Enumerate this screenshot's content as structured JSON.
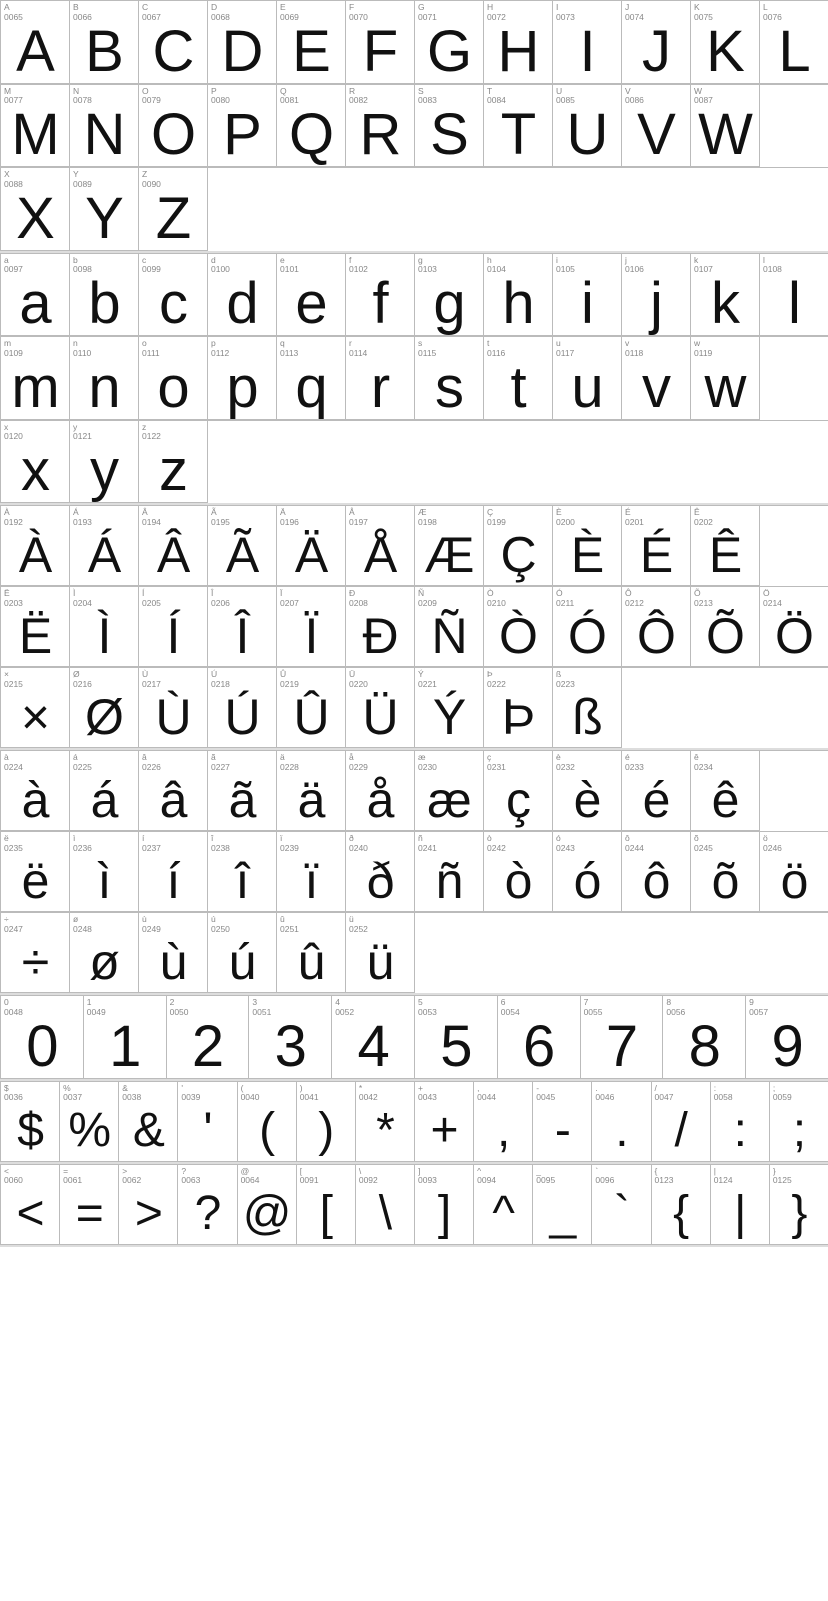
{
  "sections": [
    {
      "id": "uppercase",
      "rows": [
        {
          "cells": [
            {
              "code": "A\n0065",
              "char": "A"
            },
            {
              "code": "B\n0066",
              "char": "B"
            },
            {
              "code": "C\n0067",
              "char": "C"
            },
            {
              "code": "D\n0068",
              "char": "D"
            },
            {
              "code": "E\n0069",
              "char": "E"
            },
            {
              "code": "F\n0070",
              "char": "F"
            },
            {
              "code": "G\n0071",
              "char": "G"
            },
            {
              "code": "H\n0072",
              "char": "H"
            },
            {
              "code": "I\n0073",
              "char": "I"
            },
            {
              "code": "J\n0074",
              "char": "J"
            },
            {
              "code": "K\n0075",
              "char": "K"
            },
            {
              "code": "L\n0076",
              "char": "L"
            }
          ]
        },
        {
          "cells": [
            {
              "code": "M\n0077",
              "char": "M"
            },
            {
              "code": "N\n0078",
              "char": "N"
            },
            {
              "code": "O\n0079",
              "char": "O"
            },
            {
              "code": "P\n0080",
              "char": "P"
            },
            {
              "code": "Q\n0081",
              "char": "Q"
            },
            {
              "code": "R\n0082",
              "char": "R"
            },
            {
              "code": "S\n0083",
              "char": "S"
            },
            {
              "code": "T\n0084",
              "char": "T"
            },
            {
              "code": "U\n0085",
              "char": "U"
            },
            {
              "code": "V\n0086",
              "char": "V"
            },
            {
              "code": "W\n0087",
              "char": "W"
            }
          ]
        },
        {
          "cells": [
            {
              "code": "X\n0088",
              "char": "X"
            },
            {
              "code": "Y\n0089",
              "char": "Y"
            },
            {
              "code": "Z\n0090",
              "char": "Z"
            }
          ],
          "partial": true
        }
      ]
    },
    {
      "id": "lowercase",
      "rows": [
        {
          "cells": [
            {
              "code": "a\n0097",
              "char": "a"
            },
            {
              "code": "b\n0098",
              "char": "b"
            },
            {
              "code": "c\n0099",
              "char": "c"
            },
            {
              "code": "d\n0100",
              "char": "d"
            },
            {
              "code": "e\n0101",
              "char": "e"
            },
            {
              "code": "f\n0102",
              "char": "f"
            },
            {
              "code": "g\n0103",
              "char": "g"
            },
            {
              "code": "h\n0104",
              "char": "h"
            },
            {
              "code": "i\n0105",
              "char": "i"
            },
            {
              "code": "j\n0106",
              "char": "j"
            },
            {
              "code": "k\n0107",
              "char": "k"
            },
            {
              "code": "l\n0108",
              "char": "l"
            }
          ]
        },
        {
          "cells": [
            {
              "code": "m\n0109",
              "char": "m"
            },
            {
              "code": "n\n0110",
              "char": "n"
            },
            {
              "code": "o\n0111",
              "char": "o"
            },
            {
              "code": "p\n0112",
              "char": "p"
            },
            {
              "code": "q\n0113",
              "char": "q"
            },
            {
              "code": "r\n0114",
              "char": "r"
            },
            {
              "code": "s\n0115",
              "char": "s"
            },
            {
              "code": "t\n0116",
              "char": "t"
            },
            {
              "code": "u\n0117",
              "char": "u"
            },
            {
              "code": "v\n0118",
              "char": "v"
            },
            {
              "code": "w\n0119",
              "char": "w"
            }
          ]
        },
        {
          "cells": [
            {
              "code": "x\n0120",
              "char": "x"
            },
            {
              "code": "y\n0121",
              "char": "y"
            },
            {
              "code": "z\n0122",
              "char": "z"
            }
          ],
          "partial": true
        }
      ]
    },
    {
      "id": "accented-upper",
      "rows": [
        {
          "cells": [
            {
              "code": "À\n0192",
              "char": "À"
            },
            {
              "code": "Á\n0193",
              "char": "Á"
            },
            {
              "code": "Â\n0194",
              "char": "Â"
            },
            {
              "code": "Ã\n0195",
              "char": "Ã"
            },
            {
              "code": "Ä\n0196",
              "char": "Ä"
            },
            {
              "code": "Å\n0197",
              "char": "Å"
            },
            {
              "code": "Æ\n0198",
              "char": "Æ"
            },
            {
              "code": "Ç\n0199",
              "char": "Ç"
            },
            {
              "code": "È\n0200",
              "char": "È"
            },
            {
              "code": "É\n0201",
              "char": "É"
            },
            {
              "code": "Ê\n0202",
              "char": "Ê"
            }
          ]
        },
        {
          "cells": [
            {
              "code": "Ë\n0203",
              "char": "Ë"
            },
            {
              "code": "Ì\n0204",
              "char": "Ì"
            },
            {
              "code": "Í\n0205",
              "char": "Í"
            },
            {
              "code": "Î\n0206",
              "char": "Î"
            },
            {
              "code": "Ï\n0207",
              "char": "Ï"
            },
            {
              "code": "Ð\n0208",
              "char": "Ð"
            },
            {
              "code": "Ñ\n0209",
              "char": "Ñ"
            },
            {
              "code": "Ò\n0210",
              "char": "Ò"
            },
            {
              "code": "Ó\n0211",
              "char": "Ó"
            },
            {
              "code": "Ô\n0212",
              "char": "Ô"
            },
            {
              "code": "Õ\n0213",
              "char": "Õ"
            },
            {
              "code": "Ö\n0214",
              "char": "Ö"
            }
          ]
        },
        {
          "cells": [
            {
              "code": "×\n0215",
              "char": "×"
            },
            {
              "code": "Ø\n0216",
              "char": "Ø"
            },
            {
              "code": "Ù\n0217",
              "char": "Ù"
            },
            {
              "code": "Ú\n0218",
              "char": "Ú"
            },
            {
              "code": "Û\n0219",
              "char": "Û"
            },
            {
              "code": "Ü\n0220",
              "char": "Ü"
            },
            {
              "code": "Ý\n0221",
              "char": "Ý"
            },
            {
              "code": "Þ\n0222",
              "char": "Þ"
            },
            {
              "code": "ß\n0223",
              "char": "ß"
            }
          ],
          "partial": true
        }
      ]
    },
    {
      "id": "accented-lower",
      "rows": [
        {
          "cells": [
            {
              "code": "à\n0224",
              "char": "à"
            },
            {
              "code": "á\n0225",
              "char": "á"
            },
            {
              "code": "â\n0226",
              "char": "â"
            },
            {
              "code": "ã\n0227",
              "char": "ã"
            },
            {
              "code": "ä\n0228",
              "char": "ä"
            },
            {
              "code": "å\n0229",
              "char": "å"
            },
            {
              "code": "æ\n0230",
              "char": "æ"
            },
            {
              "code": "ç\n0231",
              "char": "ç"
            },
            {
              "code": "è\n0232",
              "char": "è"
            },
            {
              "code": "é\n0233",
              "char": "é"
            },
            {
              "code": "ê\n0234",
              "char": "ê"
            }
          ]
        },
        {
          "cells": [
            {
              "code": "ë\n0235",
              "char": "ë"
            },
            {
              "code": "ì\n0236",
              "char": "ì"
            },
            {
              "code": "í\n0237",
              "char": "í"
            },
            {
              "code": "î\n0238",
              "char": "î"
            },
            {
              "code": "ï\n0239",
              "char": "ï"
            },
            {
              "code": "ð\n0240",
              "char": "ð"
            },
            {
              "code": "ñ\n0241",
              "char": "ñ"
            },
            {
              "code": "ò\n0242",
              "char": "ò"
            },
            {
              "code": "ó\n0243",
              "char": "ó"
            },
            {
              "code": "ô\n0244",
              "char": "ô"
            },
            {
              "code": "õ\n0245",
              "char": "õ"
            },
            {
              "code": "ö\n0246",
              "char": "ö"
            }
          ]
        },
        {
          "cells": [
            {
              "code": "÷\n0247",
              "char": "÷"
            },
            {
              "code": "ø\n0248",
              "char": "ø"
            },
            {
              "code": "ù\n0249",
              "char": "ù"
            },
            {
              "code": "ú\n0250",
              "char": "ú"
            },
            {
              "code": "û\n0251",
              "char": "û"
            },
            {
              "code": "ü\n0252",
              "char": "ü"
            }
          ],
          "partial": true
        }
      ]
    },
    {
      "id": "digits",
      "rows": [
        {
          "cells": [
            {
              "code": "0\n0048",
              "char": "0"
            },
            {
              "code": "1\n0049",
              "char": "1"
            },
            {
              "code": "2\n0050",
              "char": "2"
            },
            {
              "code": "3\n0051",
              "char": "3"
            },
            {
              "code": "4\n0052",
              "char": "4"
            },
            {
              "code": "5\n0053",
              "char": "5"
            },
            {
              "code": "6\n0054",
              "char": "6"
            },
            {
              "code": "7\n0055",
              "char": "7"
            },
            {
              "code": "8\n0056",
              "char": "8"
            },
            {
              "code": "9\n0057",
              "char": "9"
            }
          ]
        }
      ]
    },
    {
      "id": "symbols1",
      "rows": [
        {
          "cells": [
            {
              "code": "$\n0036",
              "char": "$"
            },
            {
              "code": "%\n0037",
              "char": "%"
            },
            {
              "code": "&\n0038",
              "char": "&"
            },
            {
              "code": "'\n0039",
              "char": "'"
            },
            {
              "code": "(\n0040",
              "char": "("
            },
            {
              "code": ")\n0041",
              "char": ")"
            },
            {
              "code": "*\n0042",
              "char": "*"
            },
            {
              "code": "+\n0043",
              "char": "+"
            },
            {
              "code": ",\n0044",
              "char": ","
            },
            {
              "code": "-\n0045",
              "char": "-"
            },
            {
              "code": ".\n0046",
              "char": "."
            },
            {
              "code": "/\n0047",
              "char": "/"
            },
            {
              "code": ":\n0058",
              "char": ":"
            },
            {
              "code": ";\n0059",
              "char": ";"
            }
          ]
        }
      ]
    },
    {
      "id": "symbols2",
      "rows": [
        {
          "cells": [
            {
              "code": "<\n0060",
              "char": "<"
            },
            {
              "code": "=\n0061",
              "char": "="
            },
            {
              "code": ">\n0062",
              "char": ">"
            },
            {
              "code": "?\n0063",
              "char": "?"
            },
            {
              "code": "@\n0064",
              "char": "@"
            },
            {
              "code": "[\n0091",
              "char": "["
            },
            {
              "code": "\\\n0092",
              "char": "\\"
            },
            {
              "code": "]\n0093",
              "char": "]"
            },
            {
              "code": "^\n0094",
              "char": "^"
            },
            {
              "code": "_\n0095",
              "char": "_"
            },
            {
              "code": "`\n0096",
              "char": "`"
            },
            {
              "code": "{\n0123",
              "char": "{"
            },
            {
              "code": "|\n0124",
              "char": "|"
            },
            {
              "code": "}\n0125",
              "char": "}"
            }
          ]
        }
      ]
    }
  ]
}
